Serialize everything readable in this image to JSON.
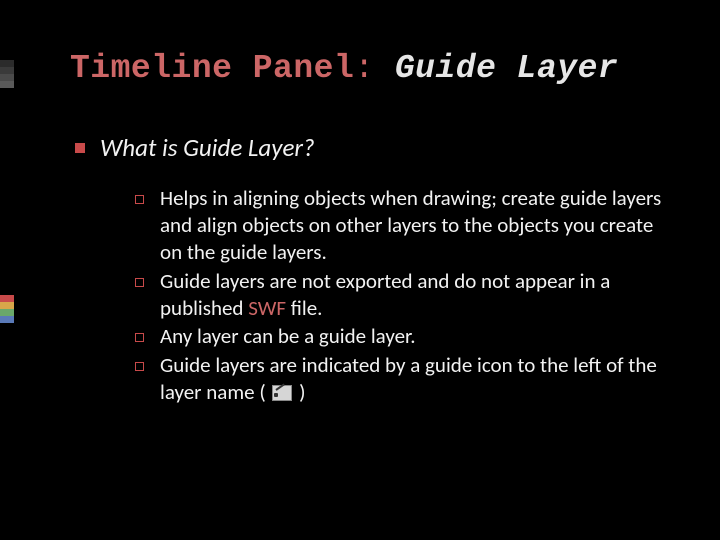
{
  "title": {
    "prefix": "Timeline Panel",
    "colon": ": ",
    "suffix": "Guide Layer"
  },
  "heading": "What is Guide Layer?",
  "bullets": [
    "Helps in aligning objects when drawing; create guide layers and align objects on other layers to the objects you create on the guide layers.",
    {
      "pre": "Guide layers are not exported and do not appear in a published ",
      "em": "SWF",
      "post": " file."
    },
    "Any layer can be a guide layer.",
    {
      "pre": "Guide layers are indicated by a guide icon to the left of the layer name ( ",
      "icon": "guide-icon",
      "post": " )"
    }
  ],
  "deco_colors_top": [
    "#2b2b2b",
    "#3a3a3a",
    "#4a4a4a",
    "#5a5a5a"
  ],
  "deco_colors_bot": [
    "#c84a4a",
    "#d8a64a",
    "#6aa86a",
    "#5a7ab8"
  ]
}
